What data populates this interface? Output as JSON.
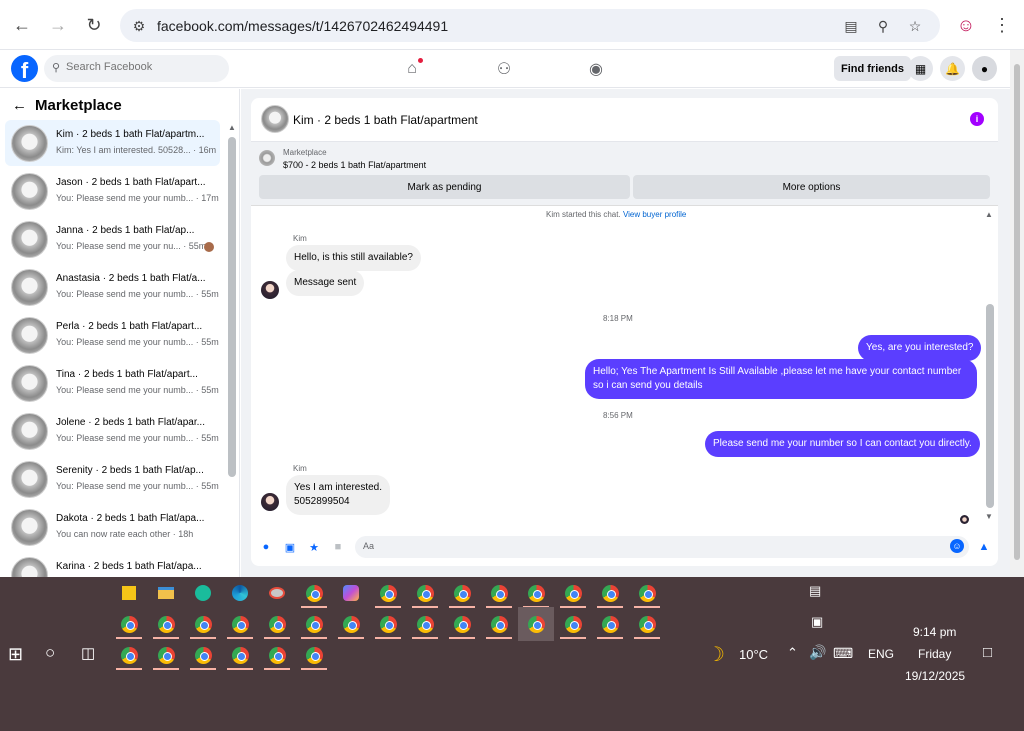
{
  "browser": {
    "url": "facebook.com/messages/t/1426702462494491"
  },
  "header": {
    "logo": "f",
    "search_placeholder": "Search Facebook",
    "find_friends": "Find friends"
  },
  "left": {
    "title": "Marketplace",
    "conversations": [
      {
        "name": "Kim · 2 beds 1 bath Flat/apartm...",
        "preview": "Kim: Yes I am interested. 50528... · 16m"
      },
      {
        "name": "Jason · 2 beds 1 bath Flat/apart...",
        "preview": "You: Please send me your numb... · 17m"
      },
      {
        "name": "Janna · 2 beds 1 bath Flat/ap...",
        "preview": "You: Please send me your nu... · 55m"
      },
      {
        "name": "Anastasia · 2 beds 1 bath Flat/a...",
        "preview": "You: Please send me your numb... · 55m"
      },
      {
        "name": "Perla · 2 beds 1 bath Flat/apart...",
        "preview": "You: Please send me your numb... · 55m"
      },
      {
        "name": "Tina · 2 beds 1 bath Flat/apart...",
        "preview": "You: Please send me your numb... · 55m"
      },
      {
        "name": "Jolene · 2 beds 1 bath Flat/apar...",
        "preview": "You: Please send me your numb... · 55m"
      },
      {
        "name": "Serenity · 2 beds 1 bath Flat/ap...",
        "preview": "You: Please send me your numb... · 55m"
      },
      {
        "name": "Dakota · 2 beds 1 bath Flat/apa...",
        "preview": "You can now rate each other · 18h"
      },
      {
        "name": "Karina · 2 beds 1 bath Flat/apa...",
        "preview": ""
      }
    ]
  },
  "chat": {
    "title": "Kim · 2 beds 1 bath Flat/apartment",
    "marketplace_label": "Marketplace",
    "listing": "$700 - 2 beds 1 bath Flat/apartment",
    "mark_pending": "Mark as pending",
    "more_options": "More options",
    "started_text": "Kim started this chat.",
    "view_profile": "View buyer profile",
    "sender1": "Kim",
    "msg_in_1": "Hello, is this still available?",
    "msg_in_2": "Message sent",
    "time1": "8:18 PM",
    "msg_out_1": "Yes, are you interested?",
    "msg_out_2_line1": "Hello; Yes The Apartment Is Still Available ,please let me have your contact number",
    "msg_out_2_line2": "so i can send you details",
    "time2": "8:56 PM",
    "msg_out_3": "Please send me your number so I can contact you directly.",
    "sender2": "Kim",
    "msg_in_3_line1": "Yes I am interested.",
    "msg_in_3_line2": "5052899504",
    "composer_placeholder": "Aa"
  },
  "taskbar": {
    "weather": "10°C",
    "lang": "ENG",
    "time": "9:14 pm",
    "day": "Friday",
    "date": "19/12/2025"
  },
  "colors": {
    "fb_blue": "#0866ff",
    "outgoing_bubble": "#5b3eff",
    "taskbar": "#4a3a3d"
  }
}
